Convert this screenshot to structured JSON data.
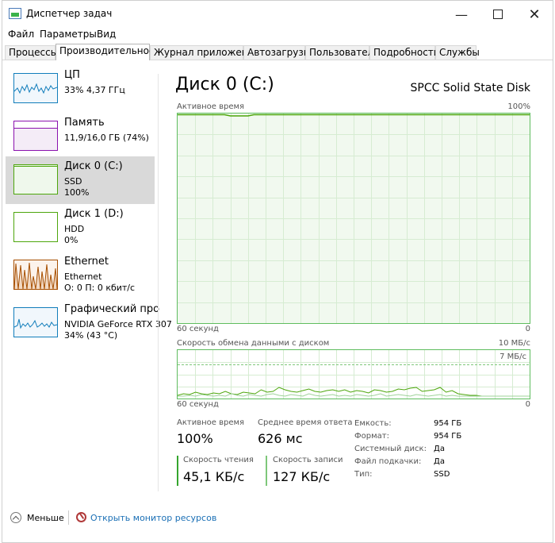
{
  "window": {
    "title": "Диспетчер задач"
  },
  "menu": {
    "file": "Файл",
    "options": "Параметры",
    "view": "Вид"
  },
  "tabs": [
    "Процессы",
    "Производительность",
    "Журнал приложений",
    "Автозагрузка",
    "Пользователи",
    "Подробности",
    "Службы"
  ],
  "sidebar": {
    "items": [
      {
        "name": "ЦП",
        "line1": "33% 4,37 ГГц",
        "line2": "",
        "color": "#117dbb"
      },
      {
        "name": "Память",
        "line1": "11,9/16,0 ГБ (74%)",
        "line2": "",
        "color": "#8b12ae"
      },
      {
        "name": "Диск 0 (C:)",
        "line1": "SSD",
        "line2": "100%",
        "color": "#4da60c"
      },
      {
        "name": "Диск 1 (D:)",
        "line1": "HDD",
        "line2": "0%",
        "color": "#4da60c"
      },
      {
        "name": "Ethernet",
        "line1": "Ethernet",
        "line2": "О: 0 П: 0 кбит/с",
        "color": "#a74f01"
      },
      {
        "name": "Графический про",
        "line1": "NVIDIA GeForce RTX 307",
        "line2": "34% (43 °C)",
        "color": "#117dbb"
      }
    ]
  },
  "main": {
    "title": "Диск 0 (C:)",
    "model": "SPCC Solid State Disk",
    "graph1": {
      "label": "Активное время",
      "max": "100%",
      "time": "60 секунд",
      "min": "0"
    },
    "graph2": {
      "label": "Скорость обмена данными с диском",
      "max": "10 МБ/с",
      "mark": "7 МБ/с",
      "time": "60 секунд",
      "min": "0"
    },
    "stats": {
      "active_label": "Активное время",
      "active_value": "100%",
      "resp_label": "Среднее время ответа",
      "resp_value": "626 мс",
      "read_label": "Скорость чтения",
      "read_value": "45,1 КБ/с",
      "write_label": "Скорость записи",
      "write_value": "127 КБ/с"
    },
    "props": [
      {
        "label": "Емкость:",
        "value": "954 ГБ"
      },
      {
        "label": "Формат:",
        "value": "954 ГБ"
      },
      {
        "label": "Системный диск:",
        "value": "Да"
      },
      {
        "label": "Файл подкачки:",
        "value": "Да"
      },
      {
        "label": "Тип:",
        "value": "SSD"
      }
    ]
  },
  "footer": {
    "less": "Меньше",
    "monitor": "Открыть монитор ресурсов"
  },
  "colors": {
    "disk_line": "#4da60c",
    "disk_border": "#5fbd5f",
    "disk_fill": "#f1f9ef",
    "grid": "#d6ecd2",
    "selected": "#d9d9d9",
    "link": "#1a6fb5"
  }
}
